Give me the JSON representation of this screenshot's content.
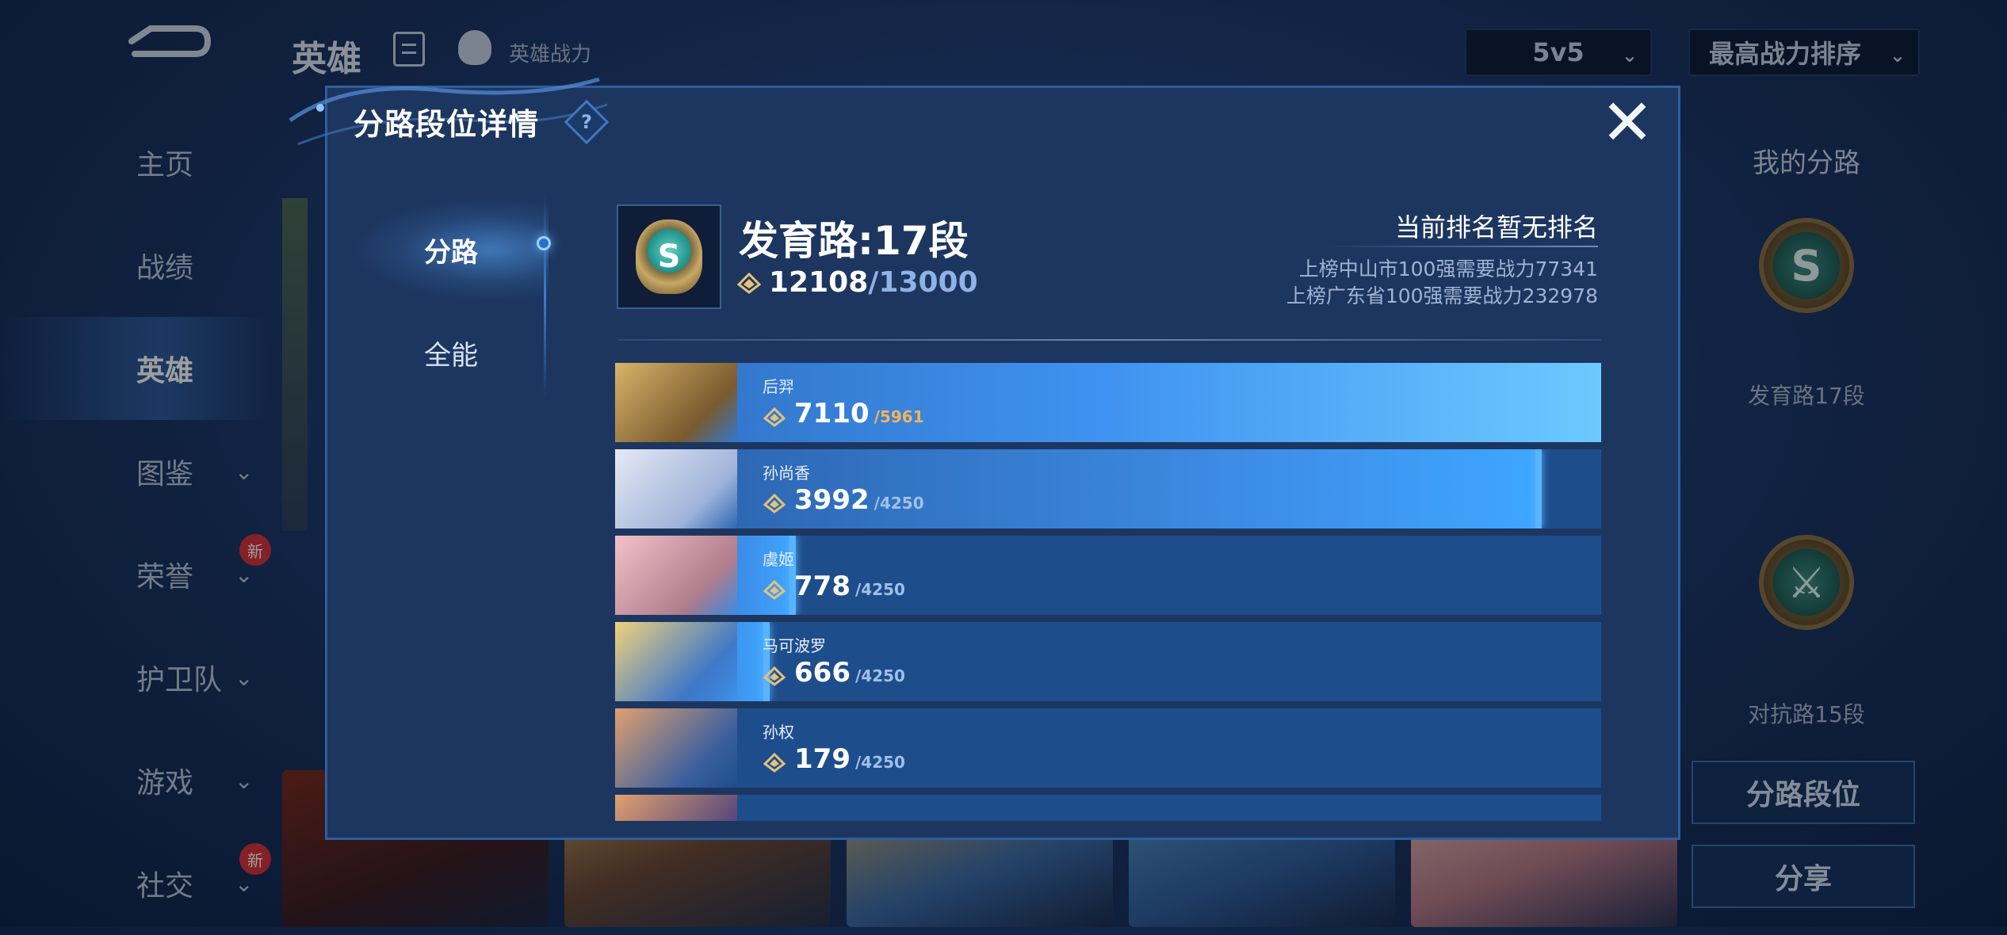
{
  "topbar": {
    "title": "英雄",
    "list_icon": "list-icon",
    "hero_power_label": "英雄战力",
    "mode_select": "5v5",
    "sort_select": "最高战力排序"
  },
  "sidenav": {
    "items": [
      {
        "label": "主页"
      },
      {
        "label": "战绩"
      },
      {
        "label": "英雄"
      },
      {
        "label": "图鉴"
      },
      {
        "label": "荣誉",
        "badge": "新"
      },
      {
        "label": "护卫队"
      },
      {
        "label": "游戏"
      },
      {
        "label": "社交",
        "badge": "新"
      }
    ]
  },
  "right_panel": {
    "title": "我的分路",
    "lane1_label": "发育路17段",
    "lane2_label": "对抗路15段",
    "lane_rank_button": "分路段位",
    "share_button": "分享"
  },
  "modal": {
    "title": "分路段位详情",
    "help_icon": "?",
    "close_icon": "✕",
    "tabs": [
      {
        "label": "分路"
      },
      {
        "label": "全能"
      }
    ],
    "lane": {
      "name": "发育路:17段",
      "power_current": "12108",
      "power_sep": "/",
      "power_target": "13000"
    },
    "rank_status": "当前排名暂无排名",
    "requirements": [
      "上榜中山市100强需要战力77341",
      "上榜广东省100强需要战力232978"
    ],
    "heroes": [
      {
        "name": "后羿",
        "power": "7110",
        "max": "/5961",
        "fill": 1.0
      },
      {
        "name": "孙尚香",
        "power": "3992",
        "max": "/4250",
        "fill": 0.94
      },
      {
        "name": "虞姬",
        "power": "778",
        "max": "/4250",
        "fill": 0.183
      },
      {
        "name": "马可波罗",
        "power": "666",
        "max": "/4250",
        "fill": 0.157
      },
      {
        "name": "孙权",
        "power": "179",
        "max": "/4250",
        "fill": 0.042
      },
      {
        "name": "",
        "power": "",
        "max": "",
        "fill": 0.04
      }
    ]
  },
  "colors": {
    "modal_bg": "#1d3660",
    "bar_base": "#1e4d8c",
    "bar_fill": "#3d8ee8",
    "accent_orange": "#f3b45a"
  }
}
